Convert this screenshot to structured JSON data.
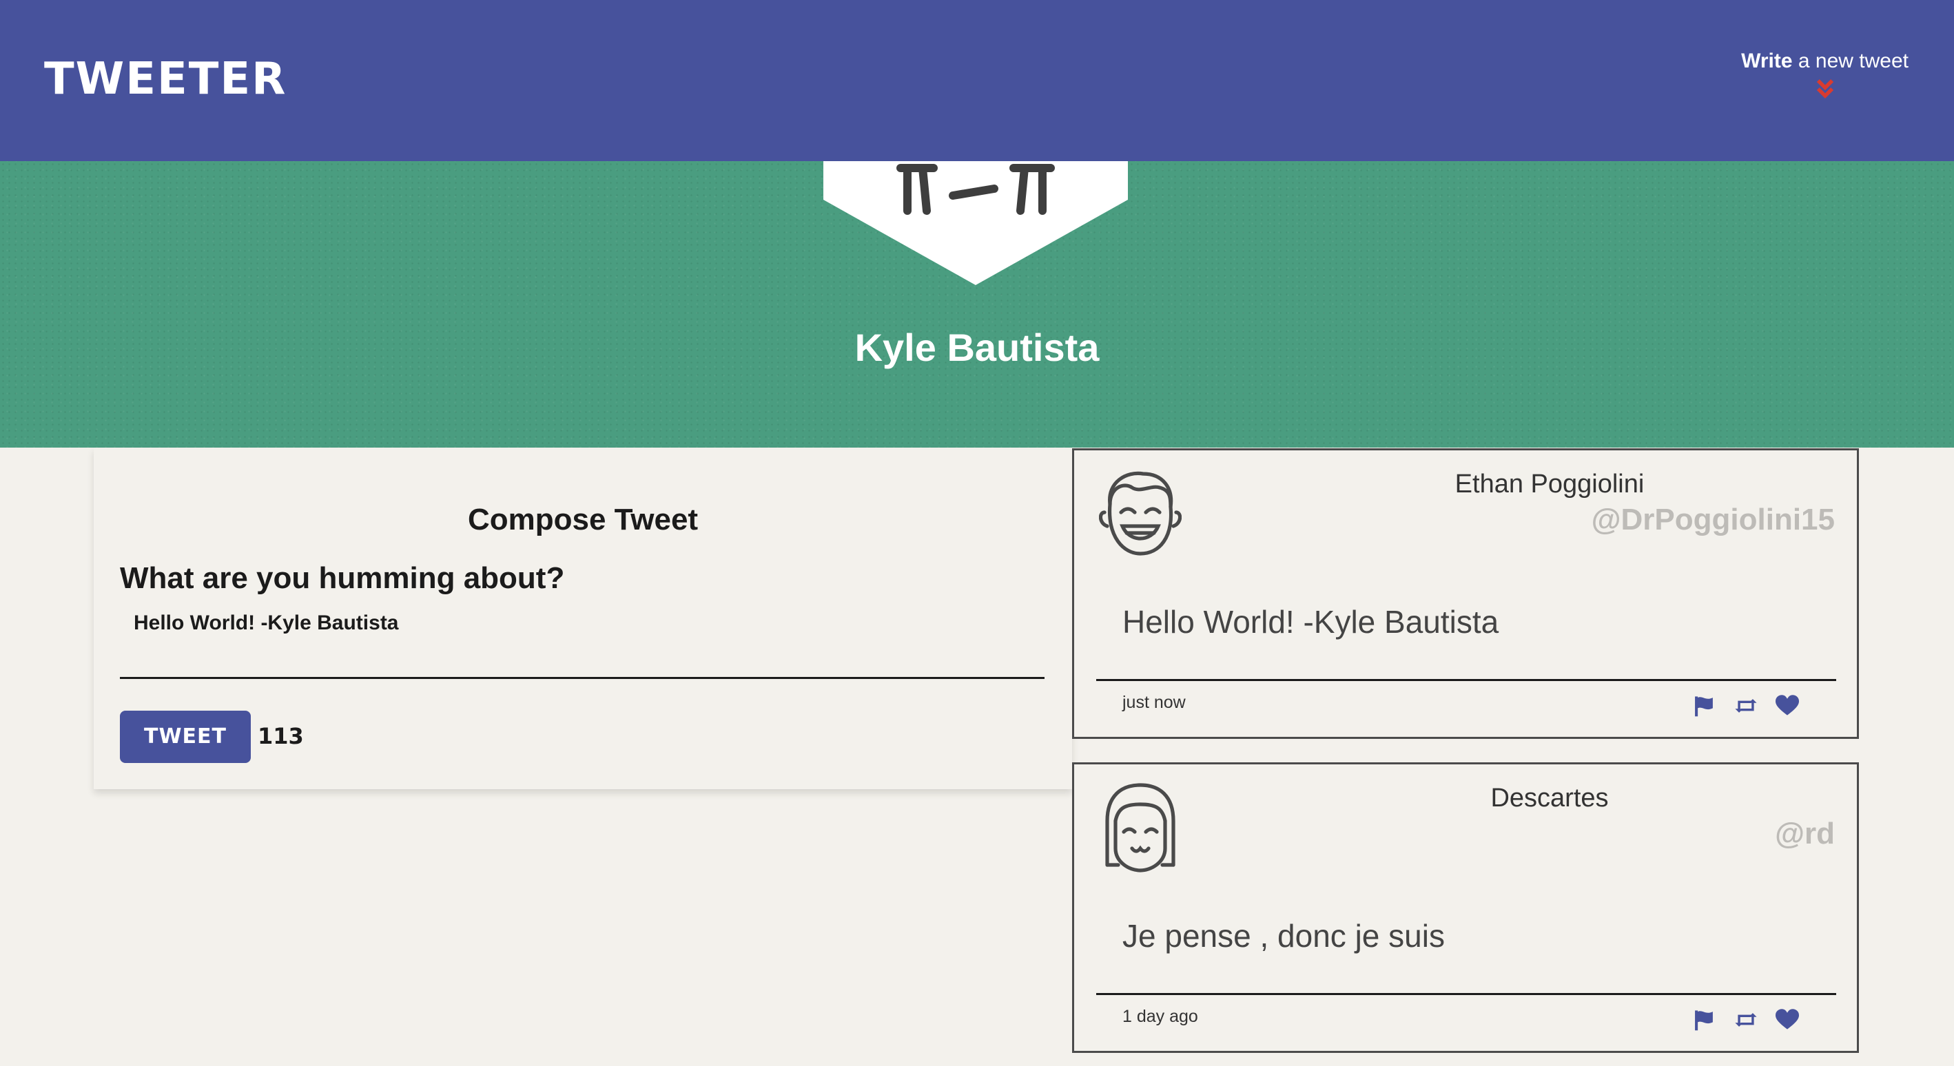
{
  "nav": {
    "logo": "TWEETER",
    "compose_bold": "Write",
    "compose_rest": " a new tweet",
    "compose_icon": "double-chevron-down-icon"
  },
  "profile": {
    "name": "Kyle Bautista"
  },
  "compose": {
    "title": "Compose Tweet",
    "prompt": "What are you humming about?",
    "text": "Hello World! -Kyle Bautista",
    "button": "TWEET",
    "counter": "113"
  },
  "tweets": [
    {
      "name": "Ethan Poggiolini",
      "handle": "@DrPoggiolini15",
      "content": "Hello World! -Kyle Bautista",
      "time": "just now"
    },
    {
      "name": "Descartes",
      "handle": "@rd",
      "content": "Je pense , donc je suis",
      "time": "1 day ago"
    }
  ],
  "colors": {
    "nav": "#47529c",
    "hero": "#4a9d80",
    "accent_red": "#d93b30",
    "action_blue": "#47529c",
    "handle_grey": "#bdbbb7"
  }
}
